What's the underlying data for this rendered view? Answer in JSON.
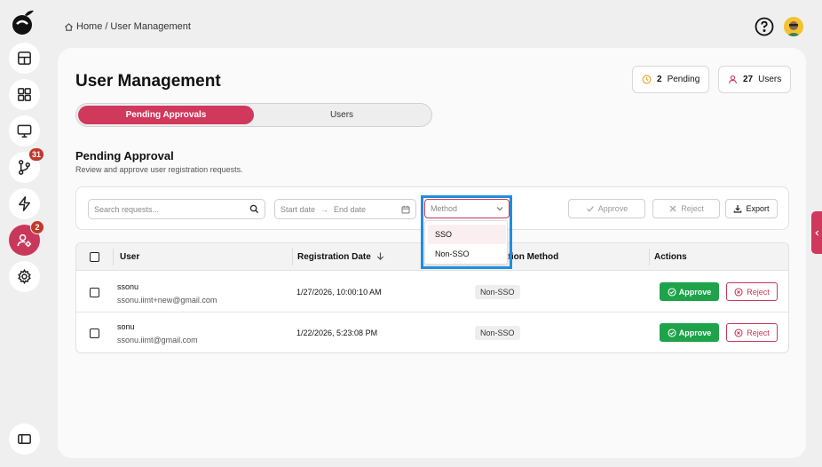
{
  "sidebar": {
    "items": [
      {
        "name": "layout-icon"
      },
      {
        "name": "grid-icon"
      },
      {
        "name": "monitor-icon"
      },
      {
        "name": "git-branch-icon",
        "badge": "31"
      },
      {
        "name": "lightning-icon"
      },
      {
        "name": "user-gear-icon",
        "badge": "2",
        "active": true
      },
      {
        "name": "settings-icon"
      }
    ]
  },
  "breadcrumb": {
    "home": "Home",
    "sep": "/",
    "current": "User Management"
  },
  "page": {
    "title": "User Management"
  },
  "stats": {
    "pending_num": "2",
    "pending_label": "Pending",
    "users_num": "27",
    "users_label": "Users"
  },
  "tabs": [
    {
      "label": "Pending Approvals"
    },
    {
      "label": "Users"
    }
  ],
  "section": {
    "title": "Pending Approval",
    "subtitle": "Review and approve user registration requests."
  },
  "toolbar": {
    "search_placeholder": "Search requests...",
    "start_date": "Start date",
    "end_date": "End date",
    "method_placeholder": "Method",
    "approve_label": "Approve",
    "reject_label": "Reject",
    "export_label": "Export"
  },
  "dropdown": {
    "options": [
      "SSO",
      "Non-SSO"
    ]
  },
  "table": {
    "headers": {
      "user": "User",
      "date": "Registration Date",
      "method": "ation Method",
      "actions": "Actions"
    },
    "rows": [
      {
        "name": "ssonu",
        "email": "ssonu.iimt+new@gmail.com",
        "date": "1/27/2026, 10:00:10 AM",
        "method": "Non-SSO"
      },
      {
        "name": "sonu",
        "email": "ssonu.iimt@gmail.com",
        "date": "1/22/2026, 5:23:08 PM",
        "method": "Non-SSO"
      }
    ],
    "approve_label": "Approve",
    "reject_label": "Reject"
  },
  "colors": {
    "accent": "#d0385c",
    "approve": "#1ea34a",
    "highlight": "#1f8ee0"
  }
}
